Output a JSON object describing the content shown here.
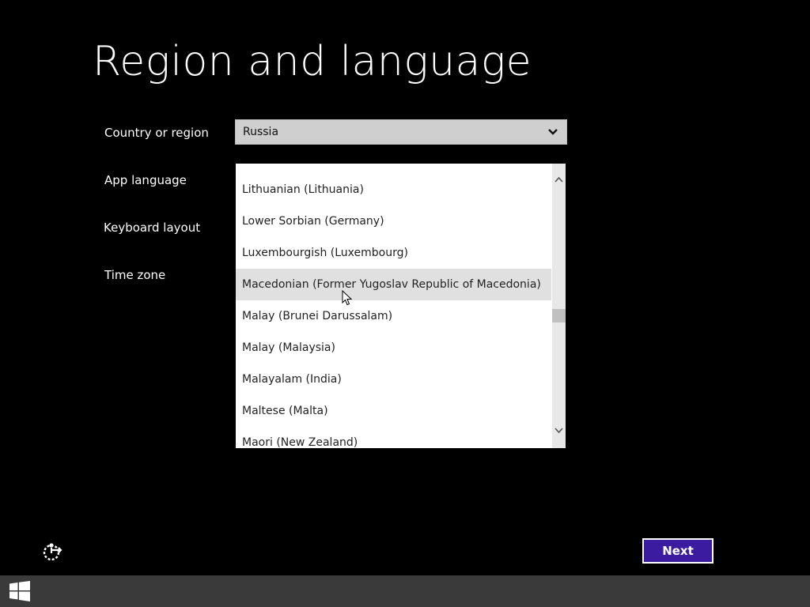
{
  "header": {
    "title": "Region and language"
  },
  "form": {
    "country_label": "Country or region",
    "app_language_label": "App language",
    "keyboard_label": "Keyboard layout",
    "timezone_label": "Time zone",
    "country_value": "Russia"
  },
  "dropdown": {
    "items": [
      "Lithuanian (Lithuania)",
      "Lower Sorbian (Germany)",
      "Luxembourgish (Luxembourg)",
      "Macedonian (Former Yugoslav Republic of Macedonia)",
      "Malay (Brunei Darussalam)",
      "Malay (Malaysia)",
      "Malayalam (India)",
      "Maltese (Malta)",
      "Maori (New Zealand)"
    ],
    "hovered_item": "Macedonian (Former Yugoslav Republic of Macedonia)"
  },
  "footer": {
    "next_label": "Next"
  },
  "icons": {
    "dropdown": "chevron-down-icon",
    "scroll_up": "chevron-up-icon",
    "scroll_down": "chevron-down-icon",
    "accessibility": "ease-of-access-icon",
    "start": "windows-logo-icon",
    "cursor": "mouse-pointer-icon"
  },
  "colors": {
    "background": "#000000",
    "accent": "#3b1ba0",
    "taskbar": "#3a3a3a",
    "hover": "#e0e0e0"
  }
}
